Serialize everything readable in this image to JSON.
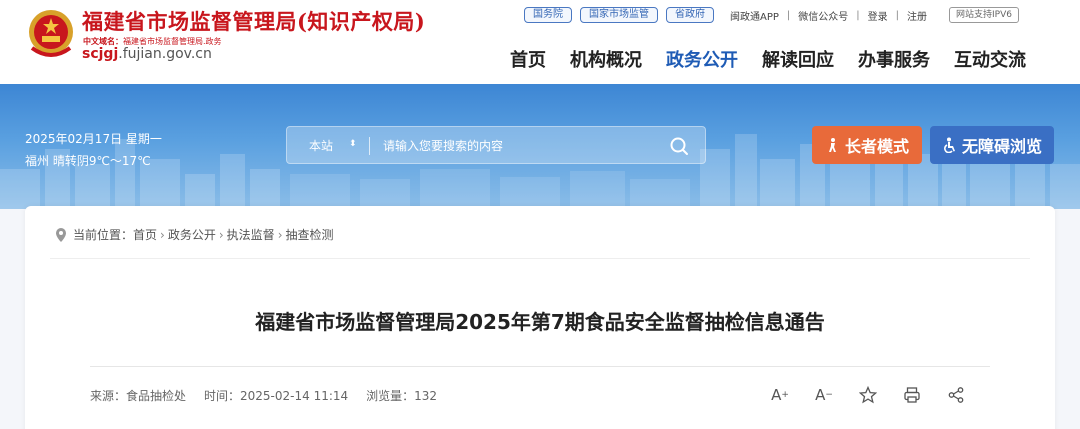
{
  "header": {
    "site_title": "福建省市场监督管理局(知识产权局)",
    "cn_domain_label": "中文域名：",
    "cn_domain_value": "福建省市场监督管理局.政务",
    "domain_prefix": "scjgj",
    "domain_rest": ".fujian.gov.cn",
    "emblem_icon": "national-emblem-icon",
    "brand_color": "#c8161d",
    "top_links": [
      {
        "label": "国务院",
        "style": "tag"
      },
      {
        "label": "国家市场监管",
        "style": "tag"
      },
      {
        "label": "省政府",
        "style": "tag"
      },
      {
        "label": "闽政通APP",
        "style": "plain"
      },
      {
        "label": "微信公众号",
        "style": "plain"
      },
      {
        "label": "登录",
        "style": "plain"
      },
      {
        "label": "注册",
        "style": "plain"
      }
    ],
    "ipv6_label": "网站支持IPV6",
    "nav": [
      {
        "label": "首页",
        "active": false
      },
      {
        "label": "机构概况",
        "active": false
      },
      {
        "label": "政务公开",
        "active": true
      },
      {
        "label": "解读回应",
        "active": false
      },
      {
        "label": "办事服务",
        "active": false
      },
      {
        "label": "互动交流",
        "active": false
      }
    ],
    "nav_active_color": "#1e5bb5"
  },
  "banner": {
    "date": "2025年02月17日 星期一",
    "weather": "福州 晴转阴9℃～17℃",
    "search_scope": "本站",
    "search_placeholder": "请输入您要搜索的内容",
    "elder_mode_label": "长者模式",
    "elder_mode_color": "#e86a3a",
    "accessibility_label": "无障碍浏览",
    "accessibility_color": "#3a6fc4"
  },
  "breadcrumb": {
    "prefix": "当前位置：",
    "items": [
      "首页",
      "政务公开",
      "执法监督",
      "抽查检测"
    ],
    "separator": "›"
  },
  "article": {
    "title": "福建省市场监督管理局2025年第7期食品安全监督抽检信息通告",
    "source": "来源：食品抽检处",
    "time": "时间：2025-02-14 11:14",
    "views": "浏览量：132",
    "tools": [
      "font-increase-icon",
      "font-decrease-icon",
      "star-icon",
      "print-icon",
      "share-icon"
    ],
    "font_increase_label": "A",
    "font_decrease_label": "A"
  }
}
